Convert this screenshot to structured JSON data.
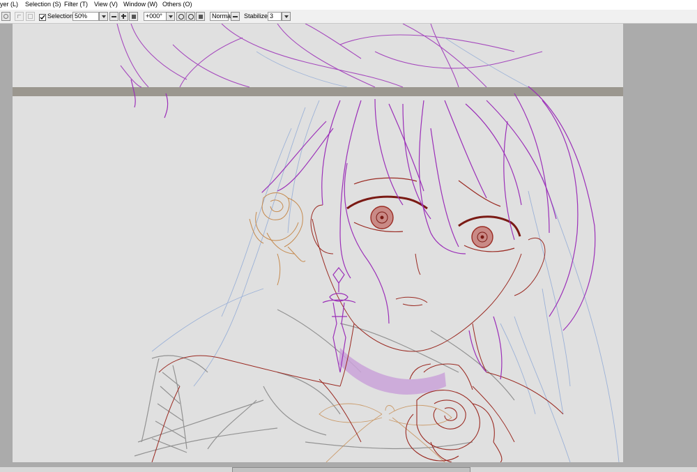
{
  "menu": {
    "items": [
      {
        "label": "yer (L)"
      },
      {
        "label": "Selection (S)"
      },
      {
        "label": "Filter (T)"
      },
      {
        "label": "View (V)"
      },
      {
        "label": "Window (W)"
      },
      {
        "label": "Others (O)"
      }
    ]
  },
  "toolbar": {
    "selection_label": "Selection",
    "selection_checked": true,
    "zoom_value": "50%",
    "rotation_value": "+000°",
    "blend_mode": "Normal",
    "stabilizer_label": "Stabilizer",
    "stabilizer_value": "3"
  },
  "scrollbar": {
    "thumb_position": 0.49
  },
  "colors": {
    "canvas_bg": "#e0e0e0",
    "workspace_bg": "#ababab",
    "sketch_purple": "#9b2fb8",
    "sketch_red": "#9a2a22",
    "sketch_orange": "#c58a4e",
    "sketch_blue": "#8fa9d6",
    "sketch_gray": "#8a8a8a",
    "choker": "#c9a2d8"
  }
}
